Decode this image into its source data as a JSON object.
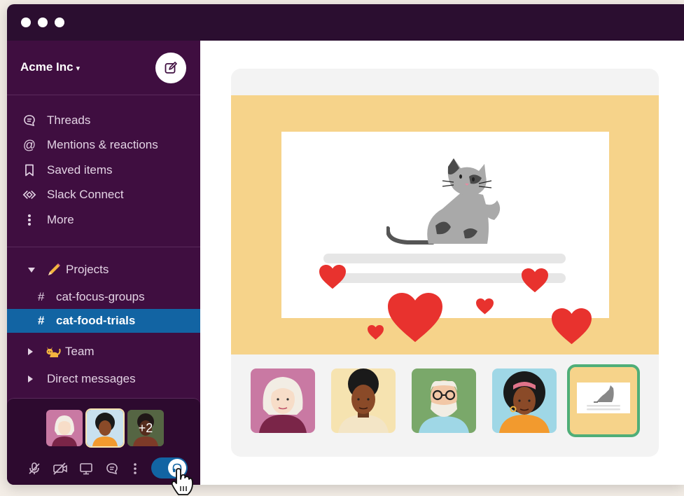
{
  "workspace": {
    "name": "Acme Inc",
    "caret": "⌄"
  },
  "nav": [
    {
      "label": "Threads",
      "icon": "threads-icon"
    },
    {
      "label": "Mentions & reactions",
      "icon": "at-icon"
    },
    {
      "label": "Saved items",
      "icon": "bookmark-icon"
    },
    {
      "label": "Slack Connect",
      "icon": "slack-connect-icon"
    },
    {
      "label": "More",
      "icon": "more-vertical-icon"
    }
  ],
  "sections": {
    "projects": {
      "label": "Projects",
      "emoji": "pencil-icon"
    },
    "team": {
      "label": "Team",
      "emoji": "cat-icon"
    },
    "dms": {
      "label": "Direct messages"
    }
  },
  "channels": [
    {
      "name": "cat-focus-groups",
      "active": false
    },
    {
      "name": "cat-food-trials",
      "active": true
    }
  ],
  "huddle": {
    "extra_count": "+2"
  },
  "colors": {
    "sidebar": "#3f0e40",
    "titlebar": "#2b0e30",
    "active": "#1264a3",
    "heart": "#e8322e",
    "yellow": "#f6d38a",
    "green": "#4fae78"
  }
}
